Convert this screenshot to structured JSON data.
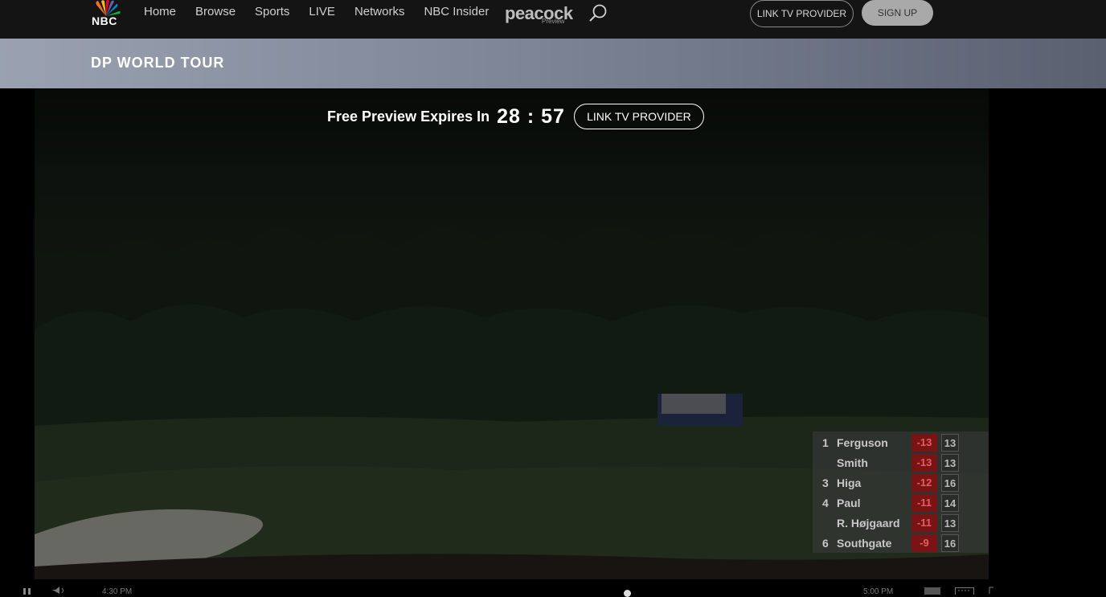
{
  "nav": {
    "logo_text": "NBC",
    "links": [
      "Home",
      "Browse",
      "Sports",
      "LIVE",
      "Networks",
      "NBC Insider"
    ],
    "peacock_label": "peacock",
    "peacock_sub": "Preview",
    "link_provider": "LINK TV PROVIDER",
    "sign_up": "SIGN UP"
  },
  "page_title": "DP WORLD TOUR",
  "preview": {
    "label": "Free Preview Expires In",
    "timer": "28 : 57",
    "link_provider": "LINK TV PROVIDER"
  },
  "leaderboard": [
    {
      "pos": "1",
      "name": "Ferguson",
      "score": "-13",
      "thru": "13"
    },
    {
      "pos": "",
      "name": "Smith",
      "score": "-13",
      "thru": "13"
    },
    {
      "pos": "3",
      "name": "Higa",
      "score": "-12",
      "thru": "16"
    },
    {
      "pos": "4",
      "name": "Paul",
      "score": "-11",
      "thru": "14"
    },
    {
      "pos": "",
      "name": "R. Højgaard",
      "score": "-11",
      "thru": "13"
    },
    {
      "pos": "6",
      "name": "Southgate",
      "score": "-9",
      "thru": "16"
    }
  ],
  "controls": {
    "start_time": "4:30 PM",
    "end_time": "5:00 PM"
  },
  "icons": {
    "search": "search-icon",
    "play_pause": "pause-icon",
    "volume": "volume-icon",
    "captions": "captions-icon",
    "keyboard": "keyboard-icon",
    "fullscreen": "fullscreen-icon"
  },
  "colors": {
    "nav_bg": "#141414",
    "score_red": "#7a1414"
  }
}
